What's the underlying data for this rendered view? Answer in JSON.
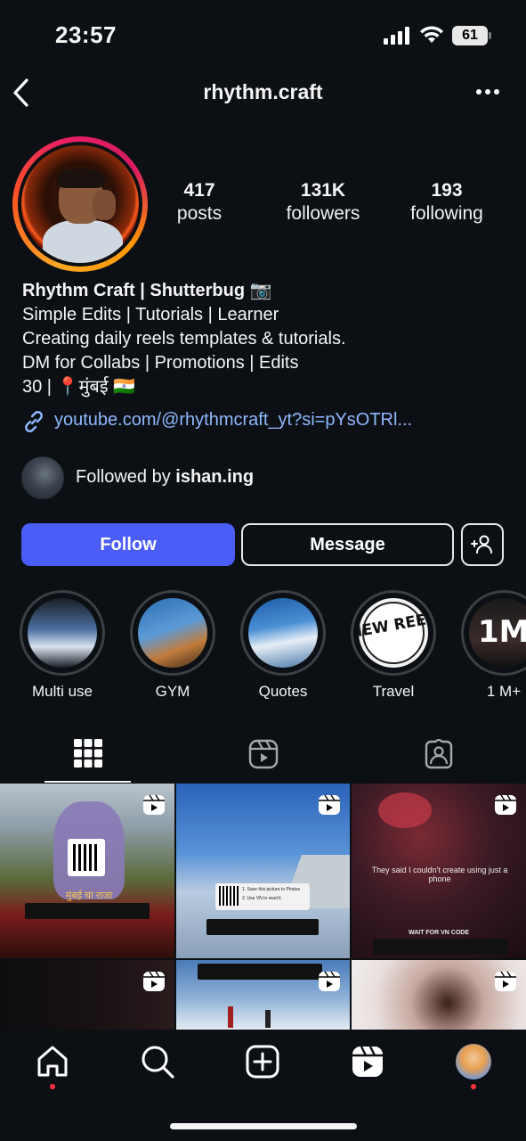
{
  "status": {
    "time": "23:57",
    "battery": "61"
  },
  "header": {
    "username": "rhythm.craft"
  },
  "stats": [
    {
      "value": "417",
      "label": "posts"
    },
    {
      "value": "131K",
      "label": "followers"
    },
    {
      "value": "193",
      "label": "following"
    }
  ],
  "bio": {
    "name": "Rhythm Craft | Shutterbug 📷",
    "lines": [
      "Simple Edits | Tutorials | Learner",
      "Creating daily reels templates & tutorials.",
      "DM for Collabs | Promotions | Edits",
      "30 | 📍मुंबई 🇮🇳"
    ],
    "link": "youtube.com/@rhythmcraft_yt?si=pYsOTRl..."
  },
  "followed_by": {
    "prefix": "Followed by ",
    "user": "ishan.ing"
  },
  "buttons": {
    "follow": "Follow",
    "message": "Message"
  },
  "highlights": [
    {
      "label": "Multi use"
    },
    {
      "label": "GYM"
    },
    {
      "label": "Quotes"
    },
    {
      "label": "Travel"
    },
    {
      "label": "1 M+"
    }
  ],
  "posts": {
    "p2_steps": [
      "1. Save this picture to Photos",
      "2. Use VN to read it"
    ],
    "p3_caption": "They said I couldn't create using just a phone",
    "p3_banner": "WAIT FOR VN CODE",
    "p1_caption": "मुंबई चा राजा"
  },
  "highlight_texts": {
    "travel_badge": "NEW REEL",
    "million_badge": "1M"
  },
  "colors": {
    "follow_button": "#4a5df9",
    "link": "#8fb8ff",
    "notification_dot": "#ff3040",
    "background": "#0c1014"
  }
}
